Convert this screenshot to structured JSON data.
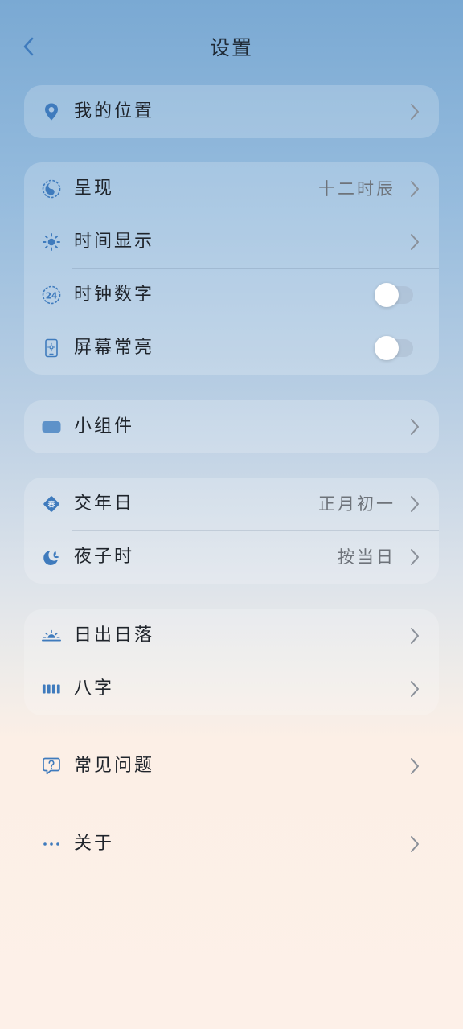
{
  "header": {
    "title": "设置",
    "back_icon": "chevron-left-icon"
  },
  "colors": {
    "accent": "#4a86c5",
    "chevron": "#8a9099",
    "toggle_track": "#b4c2d4"
  },
  "sections": {
    "location": {
      "label": "我的位置",
      "icon": "location-pin-icon"
    },
    "display": {
      "presentation": {
        "label": "呈现",
        "value": "十二时辰",
        "icon": "yin-yang-icon"
      },
      "time_display": {
        "label": "时间显示",
        "icon": "sun-icon"
      },
      "clock_digits": {
        "label": "时钟数字",
        "icon": "clock-24-icon",
        "enabled": false
      },
      "screen_on": {
        "label": "屏幕常亮",
        "icon": "phone-screen-icon",
        "enabled": false
      }
    },
    "widgets": {
      "label": "小组件",
      "icon": "widget-icon"
    },
    "calendar": {
      "year_change": {
        "label": "交年日",
        "value": "正月初一",
        "icon": "spring-diamond-icon",
        "icon_char": "春"
      },
      "midnight_hour": {
        "label": "夜子时",
        "value": "按当日",
        "icon": "moon-leaf-icon"
      }
    },
    "astro": {
      "sunrise_sunset": {
        "label": "日出日落",
        "icon": "sunrise-icon"
      },
      "bazi": {
        "label": "八字",
        "icon": "bars-icon"
      }
    },
    "help": {
      "faq": {
        "label": "常见问题",
        "icon": "question-bubble-icon"
      },
      "about": {
        "label": "关于",
        "icon": "more-dots-icon"
      }
    }
  }
}
